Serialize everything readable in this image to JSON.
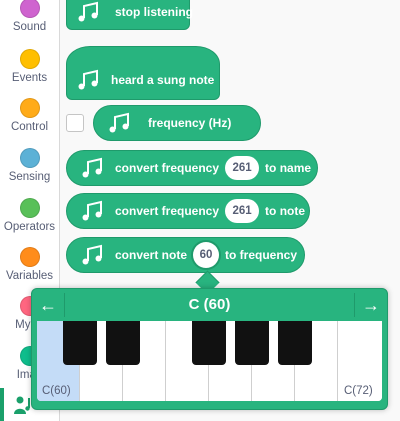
{
  "sidebar": {
    "categories": [
      {
        "label": "Sound",
        "color": "#cf63cf"
      },
      {
        "label": "Events",
        "color": "#ffbf00"
      },
      {
        "label": "Control",
        "color": "#ffab19"
      },
      {
        "label": "Sensing",
        "color": "#5cb1d6"
      },
      {
        "label": "Operators",
        "color": "#59c059"
      },
      {
        "label": "Variables",
        "color": "#ff8c1a"
      },
      {
        "label": "My Bl",
        "color": "#ff6680"
      },
      {
        "label": "Imag",
        "color": "#0fbd8c"
      }
    ],
    "extension_icon": "person-music-icon"
  },
  "blocks": {
    "stop_listening": "stop listening",
    "heard_sung_note": "heard a sung note",
    "frequency": "frequency (Hz)",
    "convert_to_name": {
      "prefix": "convert frequency",
      "value": "261",
      "suffix": "to name"
    },
    "convert_to_note": {
      "prefix": "convert frequency",
      "value": "261",
      "suffix": "to note"
    },
    "convert_note_freq": {
      "prefix": "convert note",
      "value": "60",
      "suffix": "to frequency"
    }
  },
  "piano": {
    "title": "C (60)",
    "low_label": "C(60)",
    "high_label": "C(72)",
    "selected_note": 60,
    "left_arrow": "←",
    "right_arrow": "→"
  },
  "colors": {
    "block_green": "#28b47f",
    "block_border": "#1f9a6b",
    "key_selected": "#c4dcf7"
  }
}
